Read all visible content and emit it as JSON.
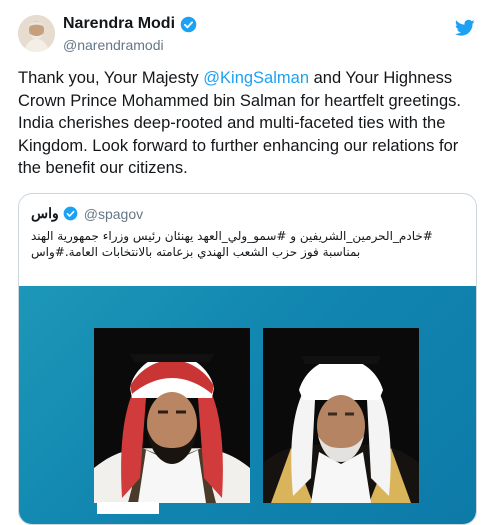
{
  "tweet": {
    "author_name": "Narendra Modi",
    "author_handle": "@narendramodi",
    "text_before": "Thank you, Your Majesty ",
    "mention": "@KingSalman",
    "text_after": " and Your Highness Crown Prince Mohammed bin Salman for heartfelt greetings. India cherishes deep-rooted and multi-faceted ties with the Kingdom. Look forward to further enhancing our relations for the benefit our citizens."
  },
  "quoted_tweet": {
    "author_name": "واس",
    "author_handle": "@spagov",
    "text": "#خادم_الحرمين_الشريفين و #سمو_ولي_العهد يهنئان رئيس وزراء جمهورية الهند بمناسبة فوز حزب الشعب الهندي بزعامته بالانتخابات العامة.#واس"
  },
  "icons": {
    "verified": "verified-badge-icon",
    "platform": "twitter-bird-icon"
  },
  "colors": {
    "accent": "#1da1f2",
    "media_background": "#1186b0"
  }
}
